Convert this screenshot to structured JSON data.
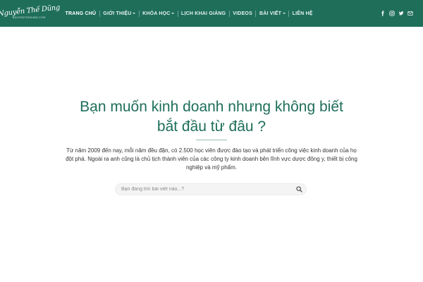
{
  "brand": {
    "logo_script": "Nguyễn Thế Dũng",
    "logo_sub": "NGUYENTHEDUNG.COM"
  },
  "nav": {
    "items": [
      {
        "label": "TRANG CHỦ",
        "active": true,
        "has_dropdown": false
      },
      {
        "label": "GIỚI THIỆU",
        "active": false,
        "has_dropdown": true
      },
      {
        "label": "KHÓA HỌC",
        "active": false,
        "has_dropdown": true
      },
      {
        "label": "LỊCH KHAI GIẢNG",
        "active": false,
        "has_dropdown": false
      },
      {
        "label": "VIDEOS",
        "active": false,
        "has_dropdown": false
      },
      {
        "label": "BÀI VIẾT",
        "active": false,
        "has_dropdown": true
      },
      {
        "label": "LIÊN HỆ",
        "active": false,
        "has_dropdown": false
      }
    ]
  },
  "socials": [
    "facebook-icon",
    "instagram-icon",
    "twitter-icon",
    "email-icon"
  ],
  "hero": {
    "title_line1": "Bạn muốn kinh doanh nhưng không biết",
    "title_line2": "bắt đầu từ đâu ?",
    "description": "Từ năm 2009 đến nay, mỗi năm đều đặn, có 2.500 học viên được đào tạo và phát triển công việc kinh doanh của họ đột phá. Ngoài ra anh cũng là chủ tịch thành viên của các công ty kinh doanh bên lĩnh vực dược đông y, thiết bị công nghiệp và mỹ phẩm."
  },
  "search": {
    "placeholder": "Bạn đang tìm bài viết nào...?",
    "value": ""
  },
  "colors": {
    "header_bg": "#1e6e5a",
    "title": "#1e6e5a"
  }
}
